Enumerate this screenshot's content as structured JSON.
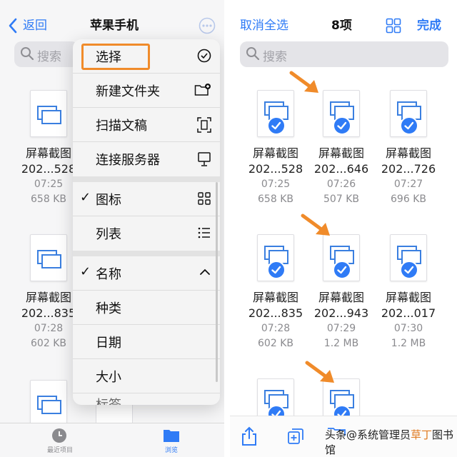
{
  "left": {
    "nav": {
      "back": "返回",
      "title": "苹果手机"
    },
    "search_placeholder": "搜索",
    "files": [
      {
        "name": "屏幕截图",
        "short": "202...528",
        "time": "07:25",
        "size": "658 KB"
      },
      {
        "name": "屏幕截图",
        "short": "202...835",
        "time": "07:28",
        "size": "602 KB"
      }
    ],
    "menu": {
      "select": "选择",
      "new_folder": "新建文件夹",
      "scan": "扫描文稿",
      "connect": "连接服务器",
      "icons": "图标",
      "list": "列表",
      "name": "名称",
      "kind": "种类",
      "date": "日期",
      "size": "大小",
      "partial": "标签"
    },
    "tabs": {
      "recent": "最近项目",
      "browse": "浏览"
    }
  },
  "right": {
    "nav": {
      "deselect": "取消全选",
      "count": "8项",
      "done": "完成"
    },
    "search_placeholder": "搜索",
    "files": [
      {
        "name": "屏幕截图",
        "short": "202...528",
        "time": "07:25",
        "size": "658 KB"
      },
      {
        "name": "屏幕截图",
        "short": "202...646",
        "time": "07:26",
        "size": "507 KB"
      },
      {
        "name": "屏幕截图",
        "short": "202...726",
        "time": "07:27",
        "size": "696 KB"
      },
      {
        "name": "屏幕截图",
        "short": "202...835",
        "time": "07:28",
        "size": "602 KB"
      },
      {
        "name": "屏幕截图",
        "short": "202...943",
        "time": "07:29",
        "size": "1.2 MB"
      },
      {
        "name": "屏幕截图",
        "short": "202...017",
        "time": "07:30",
        "size": "1.2 MB"
      }
    ]
  },
  "watermark": {
    "prefix": "头条@系统管理员",
    "brand": "草丁",
    "suffix": "图书馆"
  },
  "colors": {
    "accent": "#2f7bf6",
    "highlight": "#f08b2a"
  }
}
